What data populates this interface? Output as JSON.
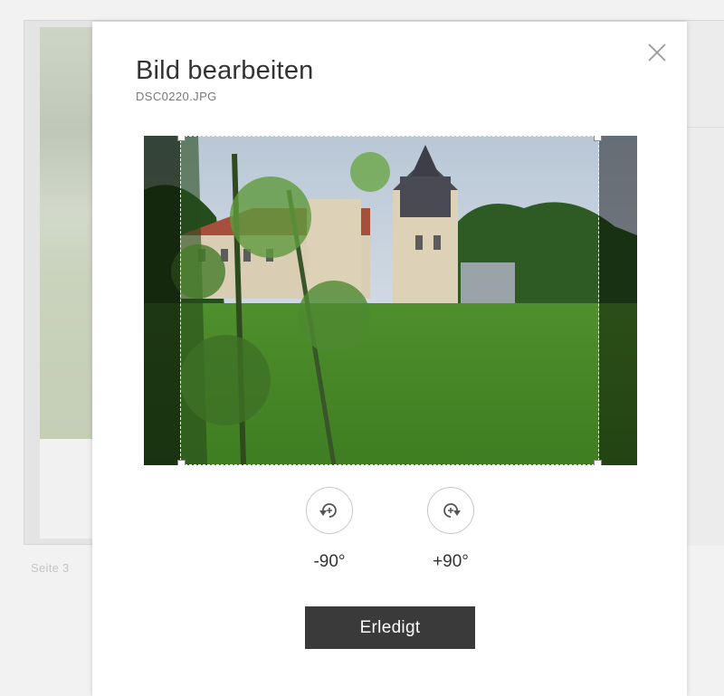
{
  "background": {
    "page_label": "Seite 3"
  },
  "modal": {
    "title": "Bild bearbeiten",
    "filename": "DSC0220.JPG",
    "close_icon": "close-icon",
    "rotate_left": {
      "icon": "rotate-counterclockwise-icon",
      "label": "-90°"
    },
    "rotate_right": {
      "icon": "rotate-clockwise-icon",
      "label": "+90°"
    },
    "done_label": "Erledigt"
  },
  "colors": {
    "primary_button": "#3a3a3a",
    "title_text": "#333333",
    "subtitle_text": "#777777"
  }
}
